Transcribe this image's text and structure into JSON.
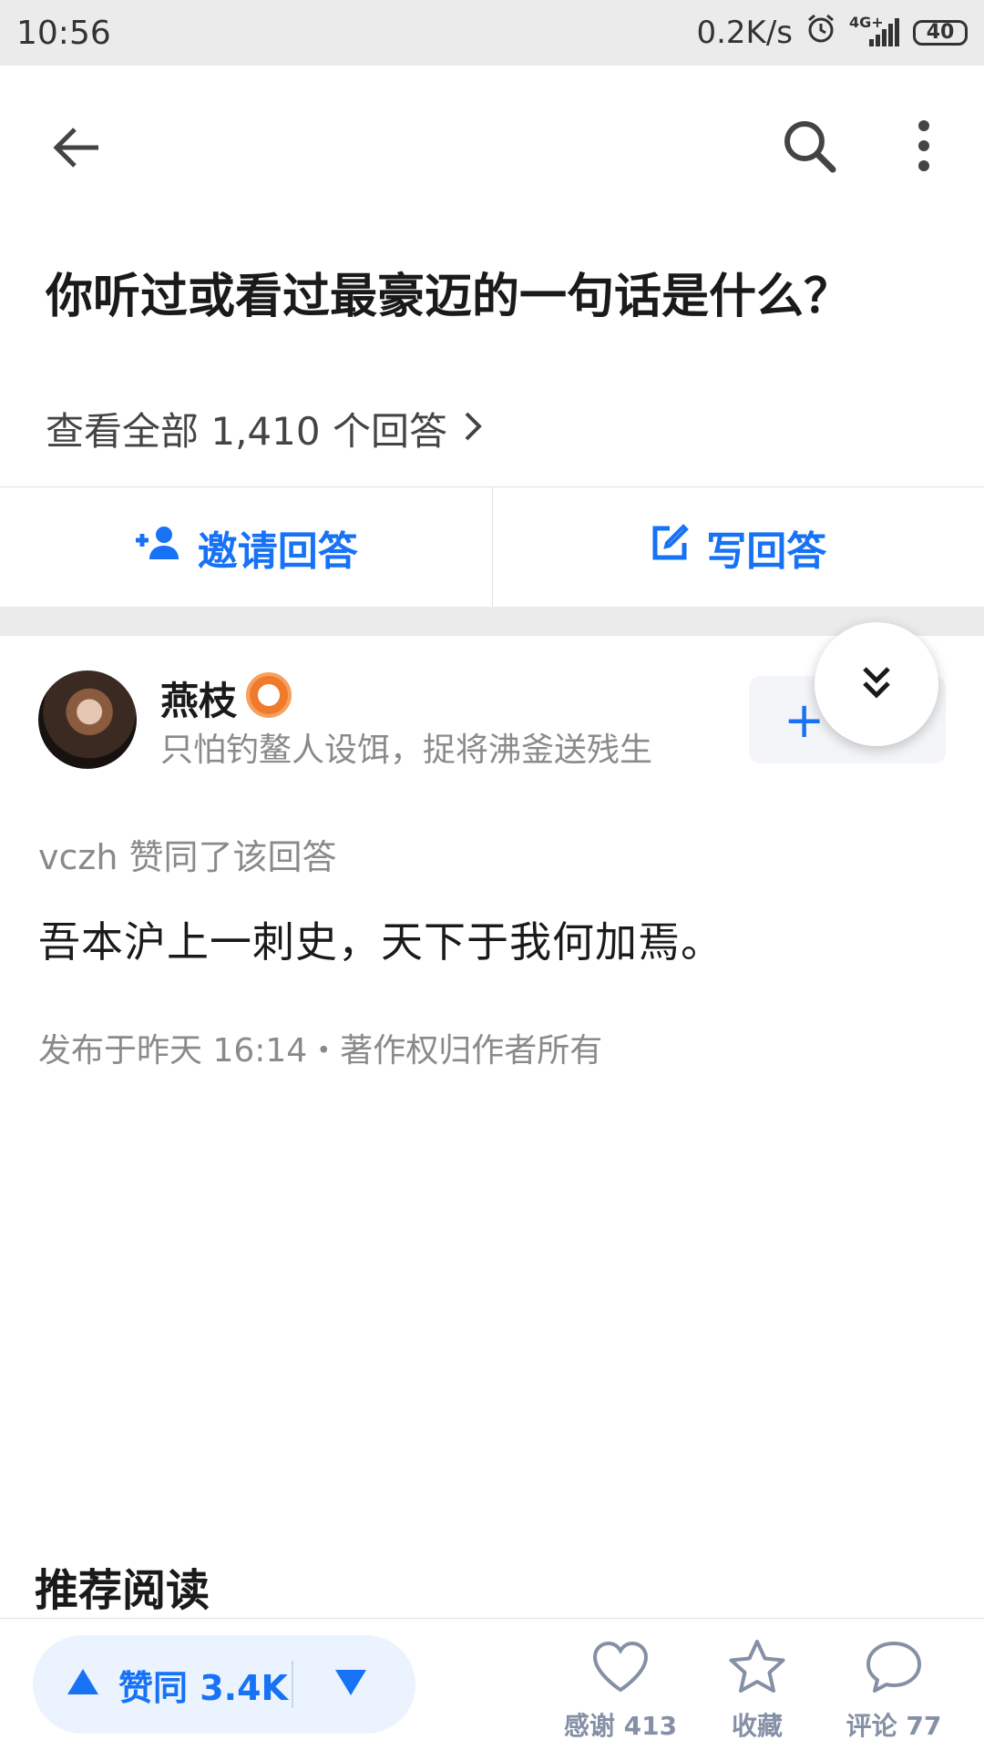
{
  "status_bar": {
    "time": "10:56",
    "network_speed": "0.2K/s",
    "network_type": "4G+",
    "battery": "40"
  },
  "header": {
    "back_icon": "arrow-left-icon",
    "search_icon": "search-icon",
    "more_icon": "more-vertical-icon"
  },
  "question": {
    "title": "你听过或看过最豪迈的一句话是什么？",
    "view_all": "查看全部 1,410 个回答"
  },
  "actions": {
    "invite_label": "邀请回答",
    "write_label": "写回答"
  },
  "author": {
    "name": "燕枝",
    "bio": "只怕钓鳌人设饵，捉将沸釜送残生",
    "follow_label": "+"
  },
  "answer": {
    "voter_line": "vczh 赞同了该回答",
    "content": "吾本沪上一刺史，天下于我何加焉。",
    "meta": "发布于昨天 16:14・著作权归作者所有"
  },
  "recommend_heading": "推荐阅读",
  "bottom_bar": {
    "upvote_label": "赞同 3.4K",
    "thanks_label": "感谢 413",
    "collect_label": "收藏",
    "comment_label": "评论 77"
  },
  "colors": {
    "accent": "#1772f6",
    "muted": "#8590a6",
    "status_bar_bg": "#ebebeb"
  }
}
